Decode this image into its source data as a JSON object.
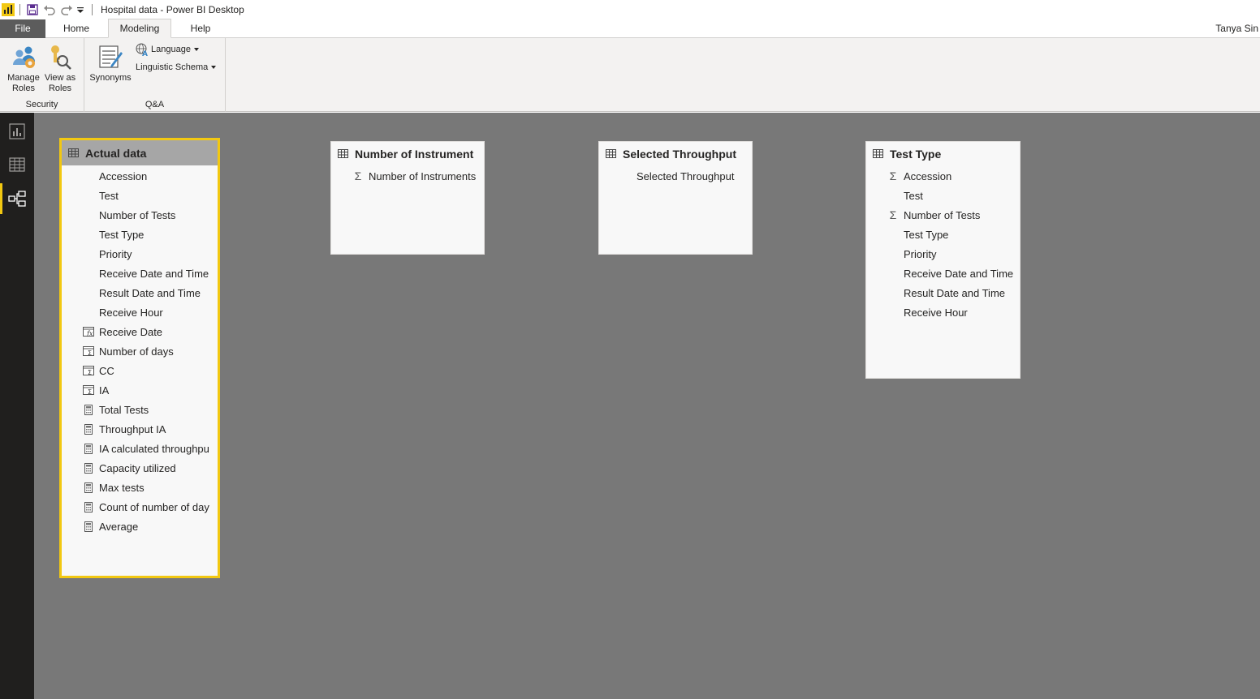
{
  "window": {
    "title": "Hospital data - Power BI Desktop"
  },
  "tabs": [
    {
      "label": "File"
    },
    {
      "label": "Home"
    },
    {
      "label": "Modeling"
    },
    {
      "label": "Help"
    }
  ],
  "user": {
    "name": "Tanya Sin"
  },
  "ribbon": {
    "security": {
      "label": "Security",
      "manage_roles_line1": "Manage",
      "manage_roles_line2": "Roles",
      "view_as_roles_line1": "View as",
      "view_as_roles_line2": "Roles"
    },
    "qa": {
      "label": "Q&A",
      "synonyms": "Synonyms",
      "language": "Language",
      "linguistic_schema": "Linguistic Schema"
    }
  },
  "colors": {
    "accent": "#f2c811",
    "canvas": "#787878",
    "nav": "#201f1e"
  },
  "tables": [
    {
      "name": "Actual data",
      "selected": true,
      "fields": [
        {
          "name": "Accession",
          "icon": "none"
        },
        {
          "name": "Test",
          "icon": "none"
        },
        {
          "name": "Number of Tests",
          "icon": "none"
        },
        {
          "name": "Test Type",
          "icon": "none"
        },
        {
          "name": "Priority",
          "icon": "none"
        },
        {
          "name": "Receive Date and Time",
          "icon": "none"
        },
        {
          "name": "Result Date and Time",
          "icon": "none"
        },
        {
          "name": "Receive Hour",
          "icon": "none"
        },
        {
          "name": "Receive Date",
          "icon": "calculated-column-icon"
        },
        {
          "name": "Number of days",
          "icon": "calculated-column-sigma-icon"
        },
        {
          "name": "CC",
          "icon": "calculated-column-sigma-icon"
        },
        {
          "name": "IA",
          "icon": "calculated-column-sigma-icon"
        },
        {
          "name": "Total Tests",
          "icon": "measure-icon"
        },
        {
          "name": "Throughput IA",
          "icon": "measure-icon"
        },
        {
          "name": "IA calculated throughpu",
          "icon": "measure-icon"
        },
        {
          "name": "Capacity utilized",
          "icon": "measure-icon"
        },
        {
          "name": "Max tests",
          "icon": "measure-icon"
        },
        {
          "name": "Count of number of day",
          "icon": "measure-icon"
        },
        {
          "name": "Average",
          "icon": "measure-icon"
        }
      ]
    },
    {
      "name": "Number of Instrument",
      "selected": false,
      "fields": [
        {
          "name": "Number of Instruments",
          "icon": "sigma-icon"
        }
      ]
    },
    {
      "name": "Selected Throughput",
      "selected": false,
      "fields": [
        {
          "name": "Selected Throughput",
          "icon": "none"
        }
      ]
    },
    {
      "name": "Test Type",
      "selected": false,
      "fields": [
        {
          "name": "Accession",
          "icon": "sigma-icon"
        },
        {
          "name": "Test",
          "icon": "none"
        },
        {
          "name": "Number of Tests",
          "icon": "sigma-icon"
        },
        {
          "name": "Test Type",
          "icon": "none"
        },
        {
          "name": "Priority",
          "icon": "none"
        },
        {
          "name": "Receive Date and Time",
          "icon": "none"
        },
        {
          "name": "Result Date and Time",
          "icon": "none"
        },
        {
          "name": "Receive Hour",
          "icon": "none"
        }
      ]
    }
  ]
}
